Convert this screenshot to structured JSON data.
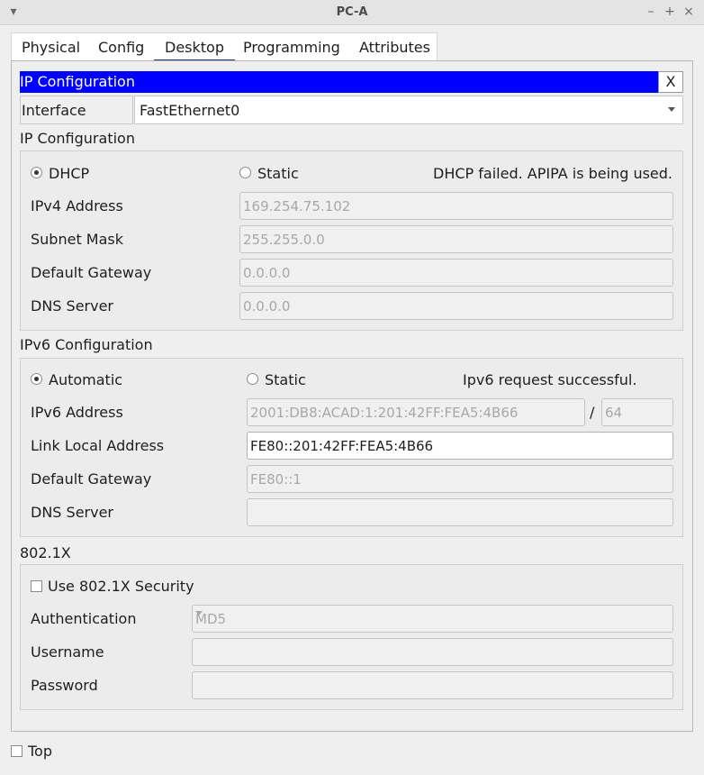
{
  "window": {
    "title": "PC-A",
    "controls": [
      "▾",
      "–",
      "+",
      "×"
    ]
  },
  "tabs": [
    {
      "label": "Physical"
    },
    {
      "label": "Config"
    },
    {
      "label": "Desktop"
    },
    {
      "label": "Programming"
    },
    {
      "label": "Attributes"
    }
  ],
  "active_tab": "Desktop",
  "header": {
    "title": "IP Configuration",
    "close_label": "X"
  },
  "interface": {
    "label": "Interface",
    "value": "FastEthernet0"
  },
  "ipv4": {
    "section_title": "IP Configuration",
    "dhcp_label": "DHCP",
    "static_label": "Static",
    "mode": "DHCP",
    "status": "DHCP failed. APIPA is being used.",
    "fields": {
      "address_label": "IPv4 Address",
      "address": "169.254.75.102",
      "mask_label": "Subnet Mask",
      "mask": "255.255.0.0",
      "gateway_label": "Default Gateway",
      "gateway": "0.0.0.0",
      "dns_label": "DNS Server",
      "dns": "0.0.0.0"
    }
  },
  "ipv6": {
    "section_title": "IPv6 Configuration",
    "auto_label": "Automatic",
    "static_label": "Static",
    "mode": "Automatic",
    "status": "Ipv6 request successful.",
    "fields": {
      "address_label": "IPv6 Address",
      "address": "2001:DB8:ACAD:1:201:42FF:FEA5:4B66",
      "slash": "/",
      "prefix": "64",
      "link_local_label": "Link Local Address",
      "link_local": "FE80::201:42FF:FEA5:4B66",
      "gateway_label": "Default Gateway",
      "gateway": "FE80::1",
      "dns_label": "DNS Server",
      "dns": ""
    }
  },
  "dot1x": {
    "section_title": "802.1X",
    "use_label": "Use 802.1X Security",
    "use_checked": false,
    "auth_label": "Authentication",
    "auth_value": "MD5",
    "username_label": "Username",
    "username": "",
    "password_label": "Password",
    "password": ""
  },
  "footer": {
    "top_label": "Top",
    "top_checked": false
  },
  "colors": {
    "header_bg": "#0000ff",
    "tab_underline": "#1f3c6e"
  }
}
